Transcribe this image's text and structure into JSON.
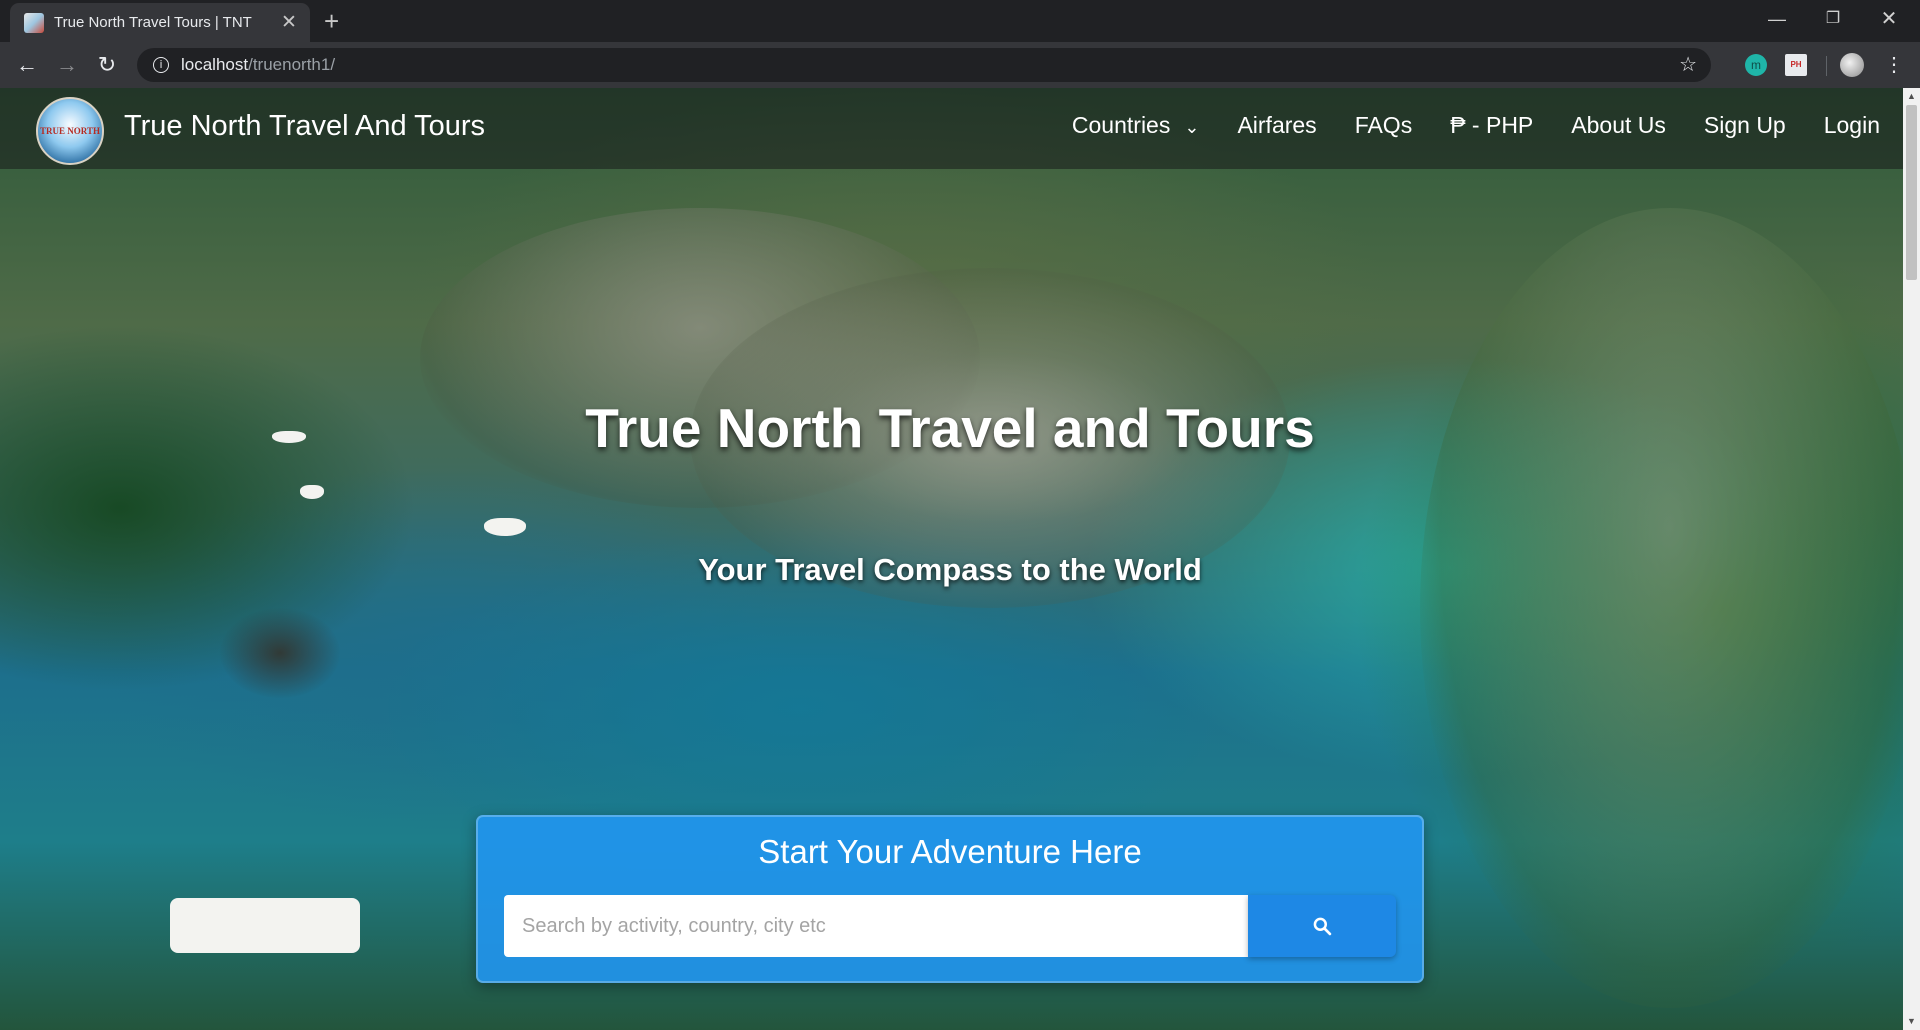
{
  "browser": {
    "tab_title": "True North Travel Tours | TNT",
    "tab_close": "✕",
    "new_tab": "+",
    "url_host": "localhost",
    "url_path": "/truenorth1/",
    "window_controls": {
      "minimize": "—",
      "maximize": "❐",
      "close": "✕"
    },
    "extension_m_label": "m",
    "extension_flag_label": "PH"
  },
  "site": {
    "logo_text": "TRUE NORTH",
    "brand_name": "True North Travel And Tours",
    "nav": [
      {
        "label": "Countries",
        "has_dropdown": true,
        "dropdown_icon": "⌄"
      },
      {
        "label": "Airfares"
      },
      {
        "label": "FAQs"
      },
      {
        "label": "₱ - PHP"
      },
      {
        "label": "About Us"
      },
      {
        "label": "Sign Up"
      },
      {
        "label": "Login"
      }
    ]
  },
  "hero": {
    "title": "True North Travel and Tours",
    "subtitle": "Your Travel Compass to the World"
  },
  "search": {
    "heading": "Start Your Adventure Here",
    "placeholder": "Search by activity, country, city etc",
    "value": ""
  },
  "icons": {
    "back": "back-arrow-icon",
    "forward": "forward-arrow-icon",
    "reload": "reload-icon",
    "info": "info-icon",
    "star": "star-icon",
    "search": "search-icon",
    "chevron": "chevron-down-icon"
  },
  "colors": {
    "accent": "#2196f3",
    "search_button": "#1e88e5",
    "navbar_overlay": "rgba(25,30,28,0.58)"
  }
}
